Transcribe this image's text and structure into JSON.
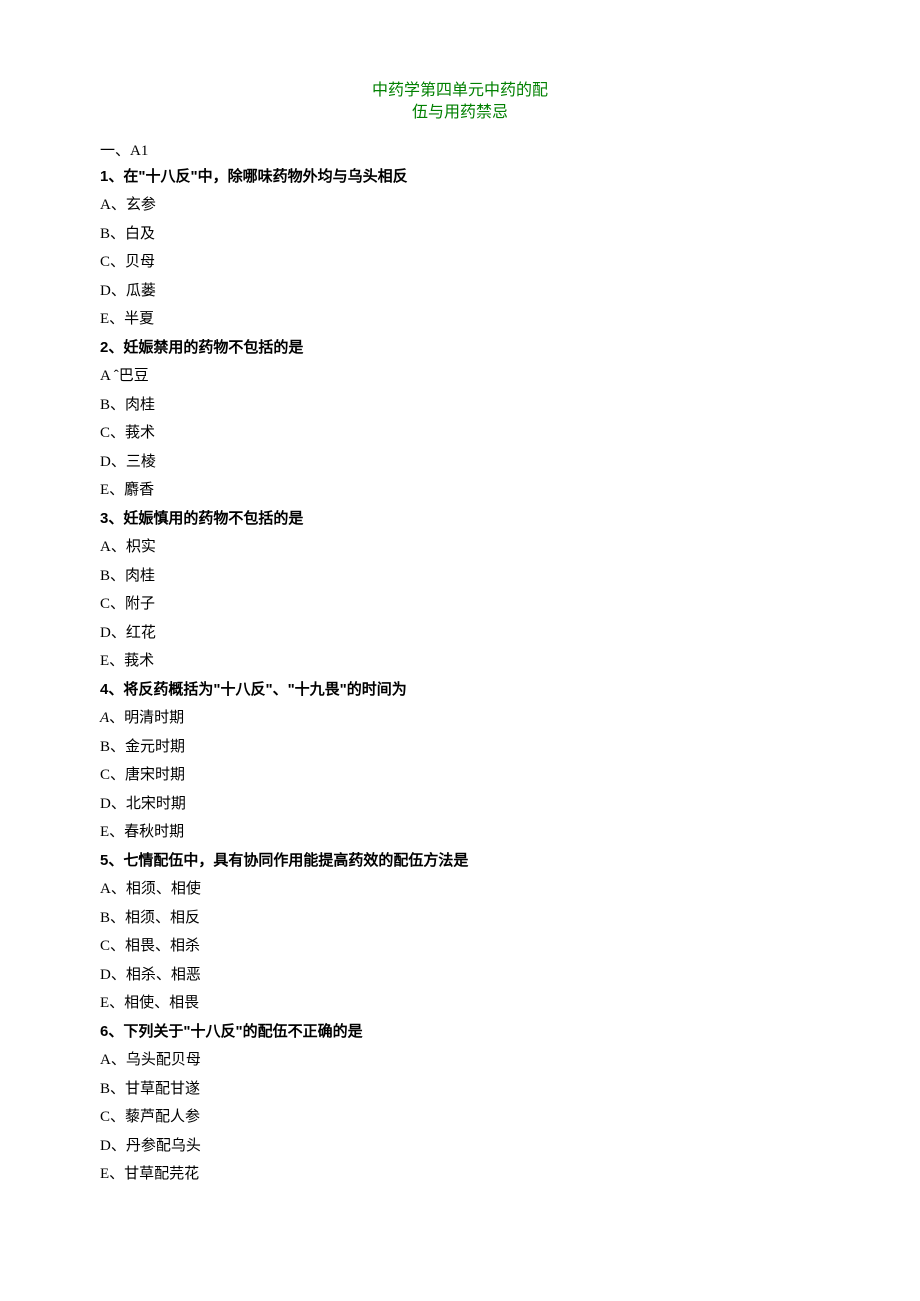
{
  "title_line1": "中药学第四单元中药的配",
  "title_line2": "伍与用药禁忌",
  "section_header": "一、A1",
  "questions": [
    {
      "stem": "1、在\"十八反\"中，除哪味药物外均与乌头相反",
      "options": [
        "A、玄参",
        "B、白及",
        "C、贝母",
        "D、瓜蒌",
        "E、半夏"
      ]
    },
    {
      "stem": "2、妊娠禁用的药物不包括的是",
      "options": [
        "A ˆ巴豆",
        "B、肉桂",
        "C、莪术",
        "D、三棱",
        "E、麝香"
      ]
    },
    {
      "stem": "3、妊娠慎用的药物不包括的是",
      "options": [
        "A、枳实",
        "B、肉桂",
        "C、附子",
        "D、红花",
        "E、莪术"
      ]
    },
    {
      "stem": "4、将反药概括为\"十八反\"、\"十九畏\"的时间为",
      "options": [
        "A、明清时期",
        "B、金元时期",
        "C、唐宋时期",
        "D、北宋时期",
        "E、春秋时期"
      ],
      "first_option_italic_a": true
    },
    {
      "stem": "5、七情配伍中，具有协同作用能提高药效的配伍方法是",
      "options": [
        "A、相须、相使",
        "B、相须、相反",
        "C、相畏、相杀",
        "D、相杀、相恶",
        "E、相使、相畏"
      ]
    },
    {
      "stem": "6、下列关于\"十八反\"的配伍不正确的是",
      "options": [
        "A、乌头配贝母",
        "B、甘草配甘遂",
        "C、藜芦配人参",
        "D、丹参配乌头",
        "E、甘草配芫花"
      ]
    }
  ]
}
